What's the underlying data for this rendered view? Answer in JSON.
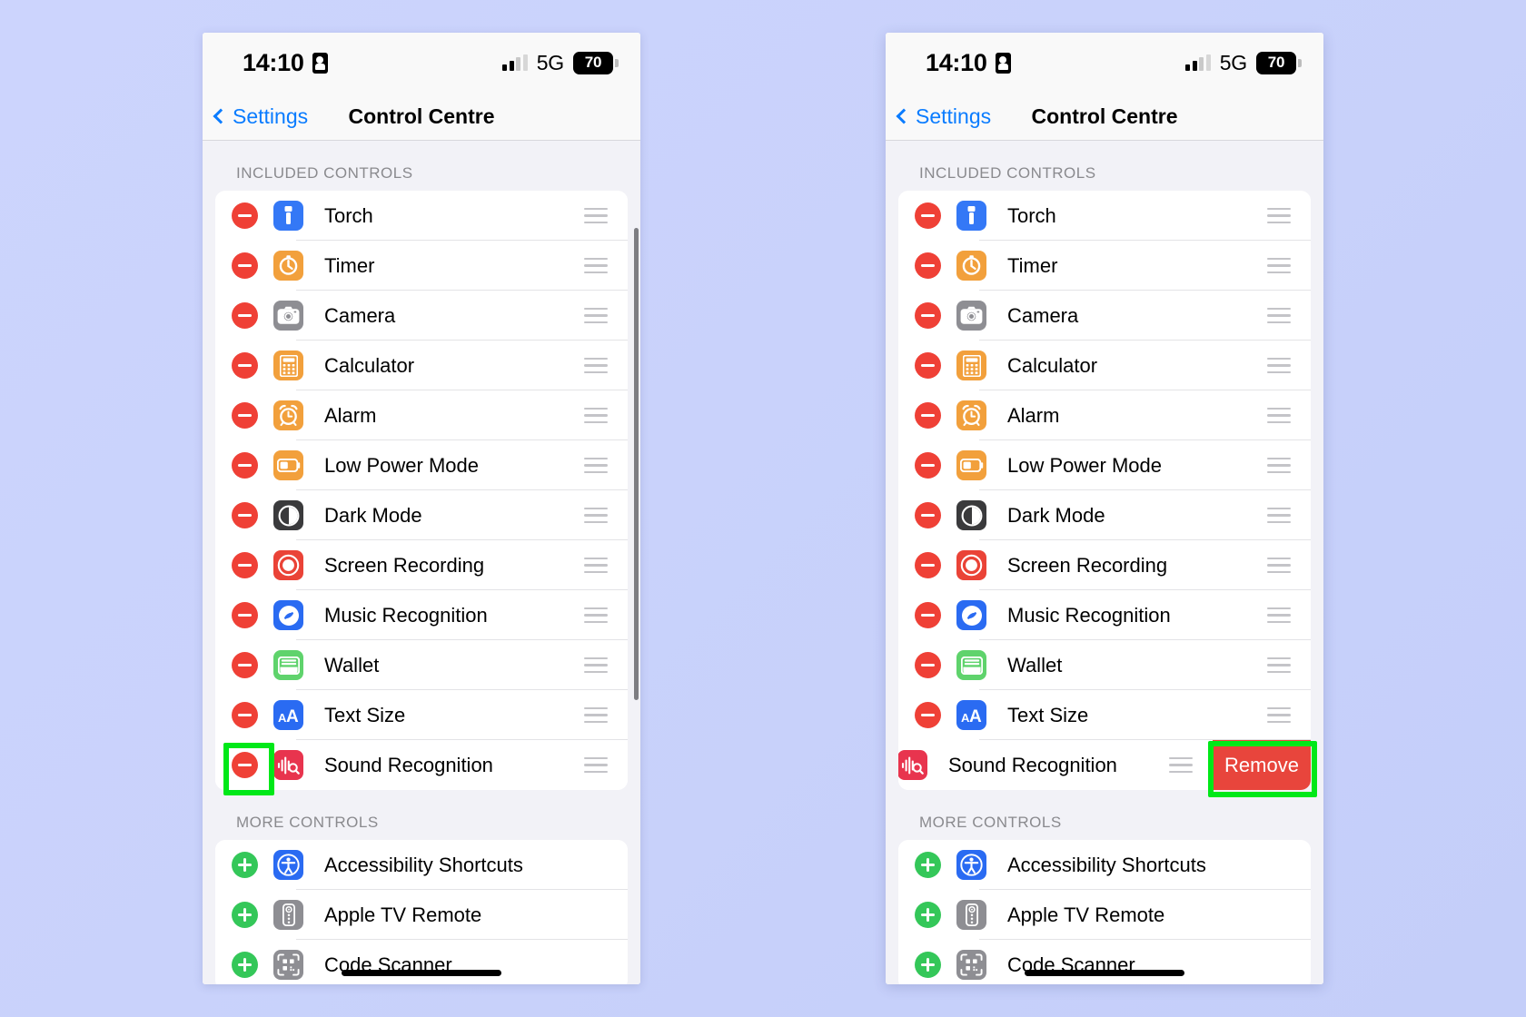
{
  "background": {
    "color_start": "#ccd4fd",
    "color_end": "#c4cef9"
  },
  "status_bar": {
    "time": "14:10",
    "lock_icon": "lock-portrait-icon",
    "network": "5G",
    "battery_percent": "70"
  },
  "nav": {
    "back_label": "Settings",
    "title": "Control Centre"
  },
  "sections": {
    "included_header": "INCLUDED CONTROLS",
    "more_header": "MORE CONTROLS"
  },
  "included_controls": [
    {
      "label": "Torch",
      "icon": "torch-icon",
      "color": "#3478f6"
    },
    {
      "label": "Timer",
      "icon": "timer-icon",
      "color": "#f2a03c"
    },
    {
      "label": "Camera",
      "icon": "camera-icon",
      "color": "#8e8e93"
    },
    {
      "label": "Calculator",
      "icon": "calculator-icon",
      "color": "#f2a03c"
    },
    {
      "label": "Alarm",
      "icon": "alarm-icon",
      "color": "#f2a03c"
    },
    {
      "label": "Low Power Mode",
      "icon": "battery-icon",
      "color": "#f2a03c"
    },
    {
      "label": "Dark Mode",
      "icon": "dark-mode-icon",
      "color": "#3a3a3c"
    },
    {
      "label": "Screen Recording",
      "icon": "record-icon",
      "color": "#ea4337"
    },
    {
      "label": "Music Recognition",
      "icon": "shazam-icon",
      "color": "#2a6bf2"
    },
    {
      "label": "Wallet",
      "icon": "wallet-icon",
      "color": "#5fd36c"
    },
    {
      "label": "Text Size",
      "icon": "text-size-icon",
      "color": "#2a6bf2"
    },
    {
      "label": "Sound Recognition",
      "icon": "sound-recognition-icon",
      "color": "#e8344e"
    }
  ],
  "more_controls": [
    {
      "label": "Accessibility Shortcuts",
      "icon": "accessibility-icon",
      "color": "#2a6bf2"
    },
    {
      "label": "Apple TV Remote",
      "icon": "tv-remote-icon",
      "color": "#8e8e93"
    },
    {
      "label": "Code Scanner",
      "icon": "qr-scanner-icon",
      "color": "#8e8e93"
    }
  ],
  "right_panel": {
    "swiped_row_label": "Sound Recognition",
    "remove_label": "Remove"
  },
  "annotations": {
    "left_highlight_target": "remove-minus-button-sound-recognition",
    "right_highlight_target": "remove-button",
    "highlight_color": "#00e818"
  }
}
